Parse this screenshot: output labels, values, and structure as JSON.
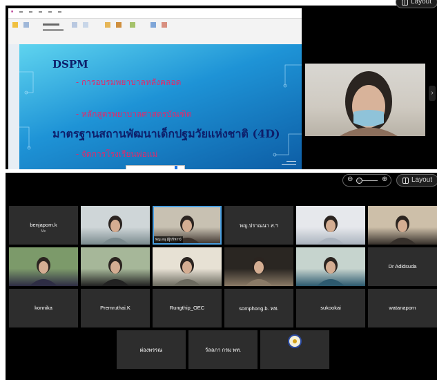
{
  "window": {
    "layout_label": "Layout"
  },
  "shared_slide": {
    "title": "DSPM",
    "line1": "- การอบรมพยาบาลหลังคลอด",
    "line2": "- หลักสูตรพยาบาลศาสตรบัณฑิต",
    "line3": "มาตรฐานสถานพัฒนาเด็กปฐมวัยแห่งชาติ (4D)",
    "line4": "- จัดการโรงเรียนพ่อแม่"
  },
  "gallery": {
    "layout_label": "Layout",
    "tiles": [
      {
        "name": "benjaporn.k",
        "sub": "Me",
        "video": false
      },
      {
        "name": "",
        "video": true
      },
      {
        "name": "",
        "tag": "พญ.อนุ (ผู้บริหาร)",
        "video": true,
        "speaking": true
      },
      {
        "name": "พญ.ปราณนา ส.ฯ",
        "video": false
      },
      {
        "name": "",
        "video": true
      },
      {
        "name": "",
        "video": true
      },
      {
        "name": "",
        "video": true
      },
      {
        "name": "",
        "video": true
      },
      {
        "name": "",
        "video": true
      },
      {
        "name": "",
        "video": true
      },
      {
        "name": "",
        "video": true
      },
      {
        "name": "Dr Adidsuda",
        "video": false
      },
      {
        "name": "konnika",
        "video": false
      },
      {
        "name": "Premruthai.K",
        "video": false
      },
      {
        "name": "Rungthip_OEC",
        "video": false
      },
      {
        "name": "somphong.b. พท.",
        "video": false
      },
      {
        "name": "sukookai",
        "video": false
      },
      {
        "name": "watanaporn",
        "video": false
      },
      {
        "name": "ผ่องพรรณ",
        "video": false
      },
      {
        "name": "วัลลภา กรม พท.",
        "video": false
      },
      {
        "name": "",
        "video": false,
        "emblem": true
      }
    ]
  },
  "colors": {
    "accent_blue": "#4a9fe0",
    "tile_bg": "#2d2d2d",
    "slide_red": "#e02a6c",
    "slide_navy": "#0d1e6a"
  }
}
